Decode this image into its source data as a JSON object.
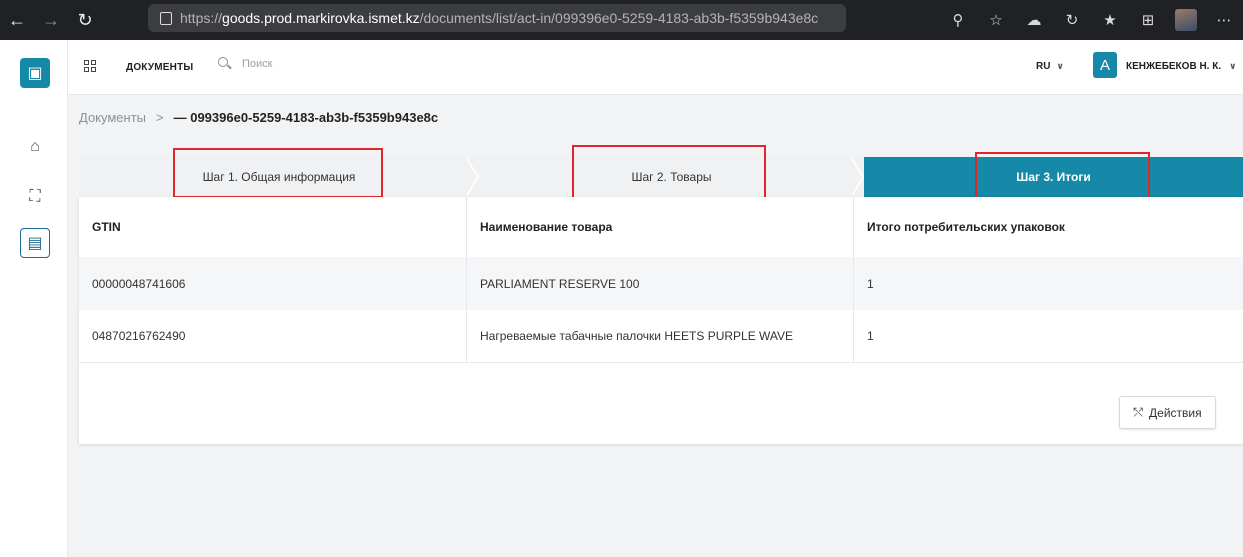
{
  "browser": {
    "url_prefix": "https://",
    "url_host": "goods.prod.markirovka.ismet.kz",
    "url_path": "/documents/list/act-in/099396e0-5259-4183-ab3b-f5359b943e8c"
  },
  "header": {
    "app_title": "ДОКУМЕНТЫ",
    "search_placeholder": "Поиск",
    "language": "RU",
    "user_initial": "A",
    "user_name": "КЕНЖЕБЕКОВ Н. К."
  },
  "breadcrumb": {
    "root": "Документы",
    "separator": ">",
    "current": "— 099396e0-5259-4183-ab3b-f5359b943e8c"
  },
  "steps": [
    {
      "label": "Шаг 1. Общая информация",
      "active": false
    },
    {
      "label": "Шаг 2. Товары",
      "active": false
    },
    {
      "label": "Шаг 3. Итоги",
      "active": true
    }
  ],
  "table": {
    "columns": [
      "GTIN",
      "Наименование товара",
      "Итого потребительских упаковок"
    ],
    "rows": [
      [
        "00000048741606",
        "PARLIAMENT RESERVE 100",
        "1"
      ],
      [
        "04870216762490",
        "Нагреваемые табачные палочки HEETS PURPLE WAVE",
        "1"
      ]
    ]
  },
  "actions": {
    "label": "Действия"
  },
  "colors": {
    "accent": "#1688a8",
    "highlight": "#e4252b",
    "browser_bar": "#202124"
  },
  "icons": [
    "back-arrow-icon",
    "forward-arrow-icon",
    "refresh-icon",
    "lock-icon",
    "zoom-icon",
    "favorite-icon",
    "collections-icon",
    "logo-icon",
    "home-icon",
    "scan-icon",
    "document-icon",
    "apps-grid-icon",
    "search-icon",
    "chevron-down-icon",
    "user-icon",
    "actions-arrow-icon"
  ]
}
